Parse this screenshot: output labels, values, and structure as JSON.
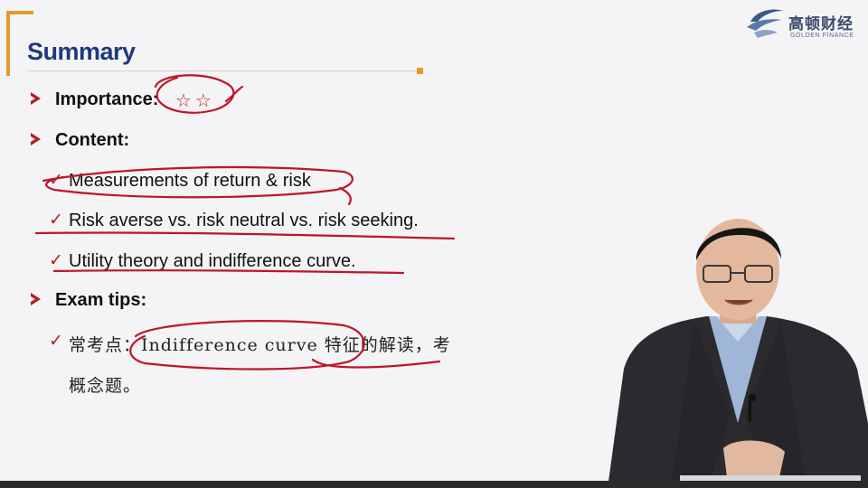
{
  "slide": {
    "title": "Summary",
    "items": {
      "importance_label": "Importance:",
      "importance_stars": "☆☆",
      "content_label": "Content:",
      "content_points": [
        "Measurements of return & risk",
        "Risk averse vs. risk neutral vs. risk seeking.",
        "Utility theory and indifference curve."
      ],
      "exam_tips_label": "Exam tips:",
      "exam_tip_line1": "常考点：Indifference curve 特征的解读，考",
      "exam_tip_line2": "概念题。"
    }
  },
  "logo": {
    "name_cn": "高顿财经",
    "name_en": "GOLDEN FINANCE"
  },
  "colors": {
    "title": "#1f3a7a",
    "accent": "#e79a2a",
    "annotation": "#c0142a",
    "bullet": "#b02020"
  },
  "icons": {
    "bullet": "arrow-bullet-icon",
    "check": "check-icon",
    "logo": "golden-finance-logo-icon"
  }
}
